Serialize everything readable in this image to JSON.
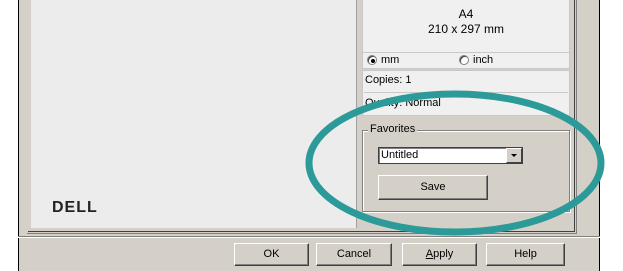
{
  "paper": {
    "name": "A4",
    "dimensions": "210 x 297 mm"
  },
  "units": {
    "selected": "mm",
    "options": [
      "mm",
      "inch"
    ]
  },
  "info": {
    "copies": "Copies: 1",
    "quality": "Quality: Normal"
  },
  "favorites": {
    "legend": "Favorites",
    "selected": "Untitled",
    "save_label": "Save"
  },
  "brand": {
    "logo_text": "DELL"
  },
  "buttons": {
    "ok": "OK",
    "cancel": "Cancel",
    "apply": "Apply",
    "apply_mnemonic": "A",
    "help": "Help"
  },
  "annotation": {
    "color": "#2b9a98"
  }
}
